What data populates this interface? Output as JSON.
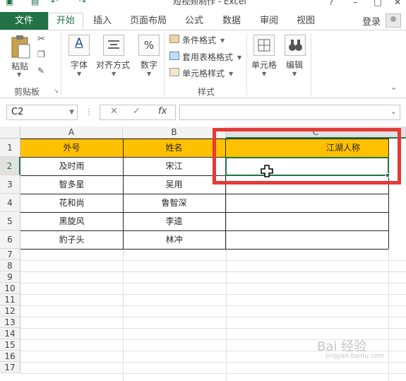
{
  "window": {
    "doc_title": "短视频制作 - Excel"
  },
  "tabs": {
    "file": "文件",
    "home": "开始",
    "insert": "插入",
    "page_layout": "页面布局",
    "formulas": "公式",
    "data": "数据",
    "review": "审阅",
    "view": "视图",
    "login": "登录"
  },
  "ribbon": {
    "paste": "粘贴",
    "clipboard_group": "剪贴板",
    "font": "字体",
    "alignment": "对齐方式",
    "number": "数字",
    "conditional_format": "条件格式",
    "table_format": "套用表格格式",
    "cell_style": "单元格样式",
    "styles_group": "样式",
    "cells": "单元格",
    "editing": "编辑",
    "number_icon": "%",
    "font_icon": "A"
  },
  "formula_bar": {
    "name_box": "C2",
    "value": ""
  },
  "columns": [
    "A",
    "B",
    "C"
  ],
  "rows": [
    "1",
    "2",
    "3",
    "4",
    "5",
    "6",
    "7",
    "8",
    "9",
    "10",
    "11",
    "12",
    "13",
    "14",
    "15",
    "16",
    "17"
  ],
  "table": {
    "headers": [
      "外号",
      "姓名",
      "江湖人称"
    ],
    "data": [
      [
        "及时雨",
        "宋江",
        ""
      ],
      [
        "智多星",
        "吴用",
        ""
      ],
      [
        "花和尚",
        "鲁智深",
        ""
      ],
      [
        "黑旋风",
        "李逵",
        ""
      ],
      [
        "豹子头",
        "林冲",
        ""
      ]
    ]
  },
  "watermark": {
    "main": "Bai 经验",
    "sub": "jingyan.baidu.com"
  },
  "colors": {
    "excel_green": "#217346",
    "header_fill": "#ffc000",
    "highlight_red": "#e53935"
  }
}
